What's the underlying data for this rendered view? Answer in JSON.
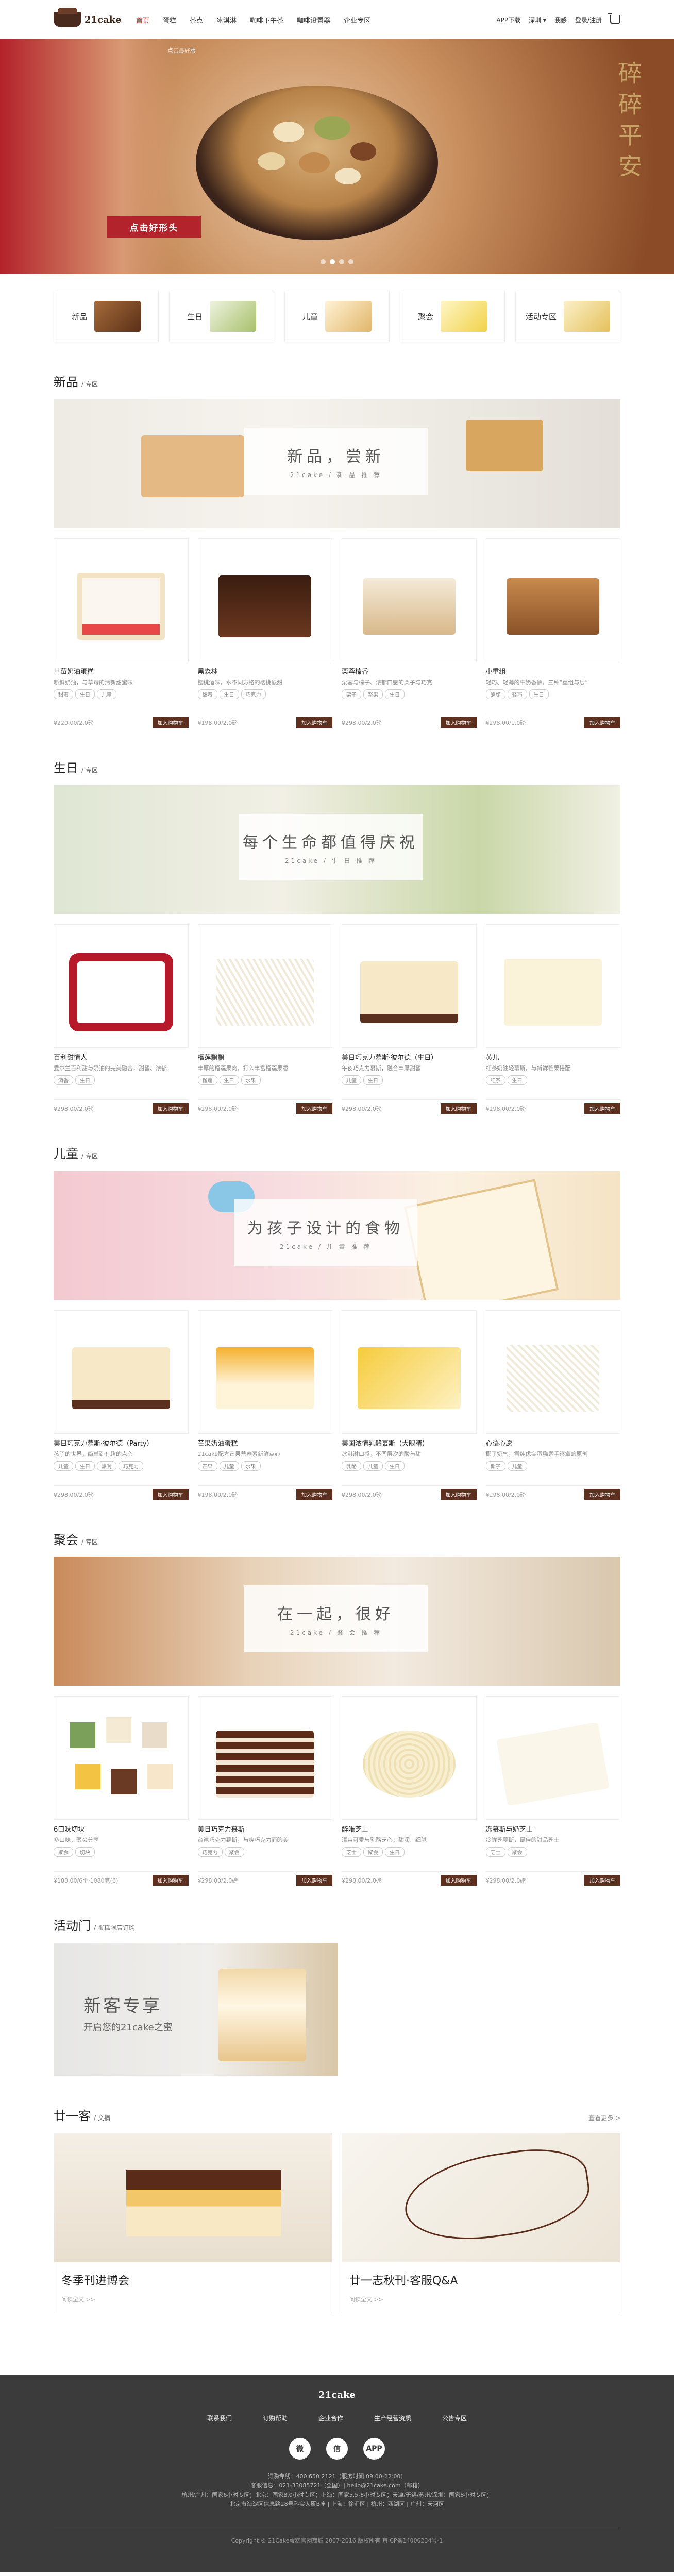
{
  "header": {
    "logo": "21cake",
    "nav": [
      "首页",
      "蛋糕",
      "茶点",
      "冰淇淋",
      "咖啡下午茶",
      "咖啡设置器",
      "企业专区"
    ],
    "app": "APP下载",
    "city": "深圳",
    "city_icon": "chevron-down-icon",
    "user": "我感",
    "login": "登录/注册",
    "cart_icon": "cart-icon"
  },
  "banner": {
    "breadcrumb": "点击最好版",
    "cta": "点击好形头",
    "poem": "碎碎平安",
    "slides": 4,
    "active_slide": 1
  },
  "categories": [
    {
      "label": "新品"
    },
    {
      "label": "生日"
    },
    {
      "label": "儿童"
    },
    {
      "label": "聚会"
    },
    {
      "label": "活动专区"
    }
  ],
  "sections": [
    {
      "title": "新品",
      "sub": "专区",
      "plate_title": "新品，尝新",
      "plate_sub": "21cake / 新 品 推 荐",
      "products": [
        {
          "name": "草莓奶油蛋糕",
          "desc": "新鲜奶油，与草莓的清新甜蜜味",
          "tags": [
            "甜蜜",
            "生日",
            "儿童"
          ],
          "price": "¥220.00/2.0磅",
          "btn": "加入购物车"
        },
        {
          "name": "黑森林",
          "desc": "樱桃酒味，水不同方格的樱桃酸甜",
          "tags": [
            "甜蜜",
            "生日",
            "巧克力"
          ],
          "price": "¥198.00/2.0磅",
          "btn": "加入购物车"
        },
        {
          "name": "栗蓉榛香",
          "desc": "栗蓉与榛子、浓郁口感的栗子与巧克",
          "tags": [
            "栗子",
            "坚果",
            "生日"
          ],
          "price": "¥298.00/2.0磅",
          "btn": "加入购物车"
        },
        {
          "name": "小重组",
          "desc": "轻巧、轻薄的牛奶香酥，三种“重组与层”",
          "tags": [
            "酥脆",
            "轻巧",
            "生日"
          ],
          "price": "¥298.00/1.0磅",
          "btn": "加入购物车"
        }
      ]
    },
    {
      "title": "生日",
      "sub": "专区",
      "plate_title": "每个生命都值得庆祝",
      "plate_sub": "21cake / 生 日 推 荐",
      "products": [
        {
          "name": "百利甜情人",
          "desc": "爱尔兰百利甜与奶油的完美融合，甜蜜、浓郁",
          "tags": [
            "酒香",
            "生日"
          ],
          "price": "¥298.00/2.0磅",
          "btn": "加入购物车"
        },
        {
          "name": "榴莲飘飘",
          "desc": "丰厚的榴莲果肉，打入丰富榴莲果香",
          "tags": [
            "榴莲",
            "生日",
            "水果"
          ],
          "price": "¥298.00/2.0磅",
          "btn": "加入购物车"
        },
        {
          "name": "美日巧克力慕斯·彼尔德（生日）",
          "desc": "午夜巧克力慕斯，融合丰厚甜蜜",
          "tags": [
            "儿童",
            "生日"
          ],
          "price": "¥298.00/2.0磅",
          "btn": "加入购物车"
        },
        {
          "name": "黄儿",
          "desc": "红茶奶油轻慕斯，与新鲜芒果搭配",
          "tags": [
            "红茶",
            "生日"
          ],
          "price": "¥298.00/2.0磅",
          "btn": "加入购物车"
        }
      ]
    },
    {
      "title": "儿童",
      "sub": "专区",
      "plate_title": "为孩子设计的食物",
      "plate_sub": "21cake / 儿 童 推 荐",
      "products": [
        {
          "name": "美日巧克力慕斯·彼尔德（Party）",
          "desc": "孩子的世界，简单到有趣的点心",
          "tags": [
            "儿童",
            "生日",
            "派对",
            "巧克力"
          ],
          "price": "¥298.00/2.0磅",
          "btn": "加入购物车"
        },
        {
          "name": "芒果奶油蛋糕",
          "desc": "21cake配方芒果营养素新鲜点心",
          "tags": [
            "芒果",
            "儿童",
            "水果"
          ],
          "price": "¥198.00/2.0磅",
          "btn": "加入购物车"
        },
        {
          "name": "美国浓情乳酪慕斯（大眼睛）",
          "desc": "冰淇淋口感，不同层次的酸与甜",
          "tags": [
            "乳酪",
            "儿童",
            "生日"
          ],
          "price": "¥298.00/2.0磅",
          "btn": "加入购物车"
        },
        {
          "name": "心语心愿",
          "desc": "椰子奶气，雪纯优实蛋糕素手滚拿的原创",
          "tags": [
            "椰子",
            "儿童"
          ],
          "price": "¥298.00/2.0磅",
          "btn": "加入购物车"
        }
      ]
    },
    {
      "title": "聚会",
      "sub": "专区",
      "plate_title": "在一起，很好",
      "plate_sub": "21cake / 聚 会 推 荐",
      "products": [
        {
          "name": "6口味切块",
          "desc": "多口味，聚会分享",
          "tags": [
            "聚会",
            "切块"
          ],
          "price": "¥180.00/6个·1080克(6)",
          "btn": "加入购物车"
        },
        {
          "name": "美日巧克力慕斯",
          "desc": "台湾巧克力慕斯，与爽巧克力面的美",
          "tags": [
            "巧克力",
            "聚会"
          ],
          "price": "¥298.00/2.0磅",
          "btn": "加入购物车"
        },
        {
          "name": "醉唯芝士",
          "desc": "清爽可爱与乳酪芝心，甜润、细腻",
          "tags": [
            "芝士",
            "聚会",
            "生日"
          ],
          "price": "¥298.00/2.0磅",
          "btn": "加入购物车"
        },
        {
          "name": "冻慕斯与奶芝士",
          "desc": "冷鲜芝慕斯，最佳的甜品芝士",
          "tags": [
            "芝士",
            "聚会"
          ],
          "price": "¥298.00/2.0磅",
          "btn": "加入购物车"
        }
      ]
    }
  ],
  "activity": {
    "title": "活动门",
    "sub": "蛋糕限店订购",
    "t1": "新客专享",
    "t2": "开启您的21cake之蜜"
  },
  "articles": {
    "title": "廿一客",
    "sub": "文摘",
    "more": "查看更多 >",
    "items": [
      {
        "title": "冬季刊进博会",
        "more": "阅读全文 >>"
      },
      {
        "title": "廿一志秋刊·客服Q&A",
        "more": "阅读全文 >>"
      }
    ]
  },
  "footer": {
    "logo": "21cake",
    "links": [
      "联系我们",
      "订购帮助",
      "企业合作",
      "生产经营资质",
      "公告专区"
    ],
    "icons": [
      "weibo-icon",
      "wechat-icon",
      "app-icon"
    ],
    "icon_labels": [
      "微",
      "信",
      "APP"
    ],
    "info": [
      "订购专线：400 650 2121（服务时间 09:00-22:00）",
      "客服信息：021-33085721（全国）| hello@21cake.com（邮箱）",
      "杭州/广州：国家6小时专区；北京：国家8.0小时专区；上海：国家5.5-8小时专区；天津/无锡/苏州/深圳：国家8小时专区；",
      "北京市海淀区信息路28号科实大厦B座 | 上海：徐汇区 | 杭州：西湖区 | 广州：天河区"
    ],
    "copyright": "Copyright © 21Cake蛋糕官网商城 2007-2016 版权所有 京ICP备14006234号-1"
  }
}
